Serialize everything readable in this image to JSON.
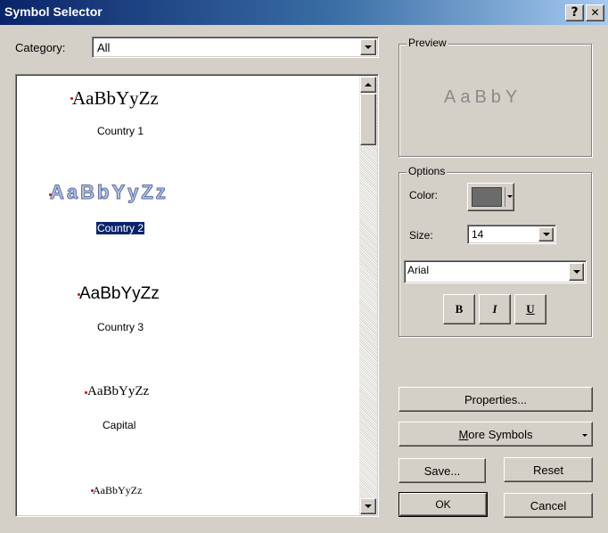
{
  "window": {
    "title": "Symbol Selector",
    "help_button": "?",
    "close_button": "✕"
  },
  "category": {
    "label": "Category:",
    "value": "All"
  },
  "symbols": [
    {
      "sample": "AaBbYyZz",
      "name": "Country 1",
      "style": "serif-large"
    },
    {
      "sample": "AaBbYyZz",
      "name": "Country 2",
      "style": "halo-blue",
      "selected": true
    },
    {
      "sample": "AaBbYyZz",
      "name": "Country 3",
      "style": "sans-bold"
    },
    {
      "sample": "AaBbYyZz",
      "name": "Capital",
      "style": "serif-medium"
    },
    {
      "sample": "AaBbYyZz",
      "name": "",
      "style": "serif-small"
    }
  ],
  "preview": {
    "label": "Preview",
    "sample": "AaBbY",
    "color": "#8a8a8a"
  },
  "options": {
    "label": "Options",
    "color_label": "Color:",
    "color_value": "#6b6b6b",
    "size_label": "Size:",
    "size_value": "14",
    "font_value": "Arial",
    "bold": "B",
    "italic": "I",
    "underline": "U"
  },
  "buttons": {
    "properties": "Properties...",
    "more_symbols_prefix": "M",
    "more_symbols_rest": "ore Symbols",
    "save": "Save...",
    "reset": "Reset",
    "ok": "OK",
    "cancel": "Cancel"
  },
  "colors": {
    "selection": "#0a246a",
    "marker": "#e00000",
    "halo_text": "#6f7fb0"
  }
}
